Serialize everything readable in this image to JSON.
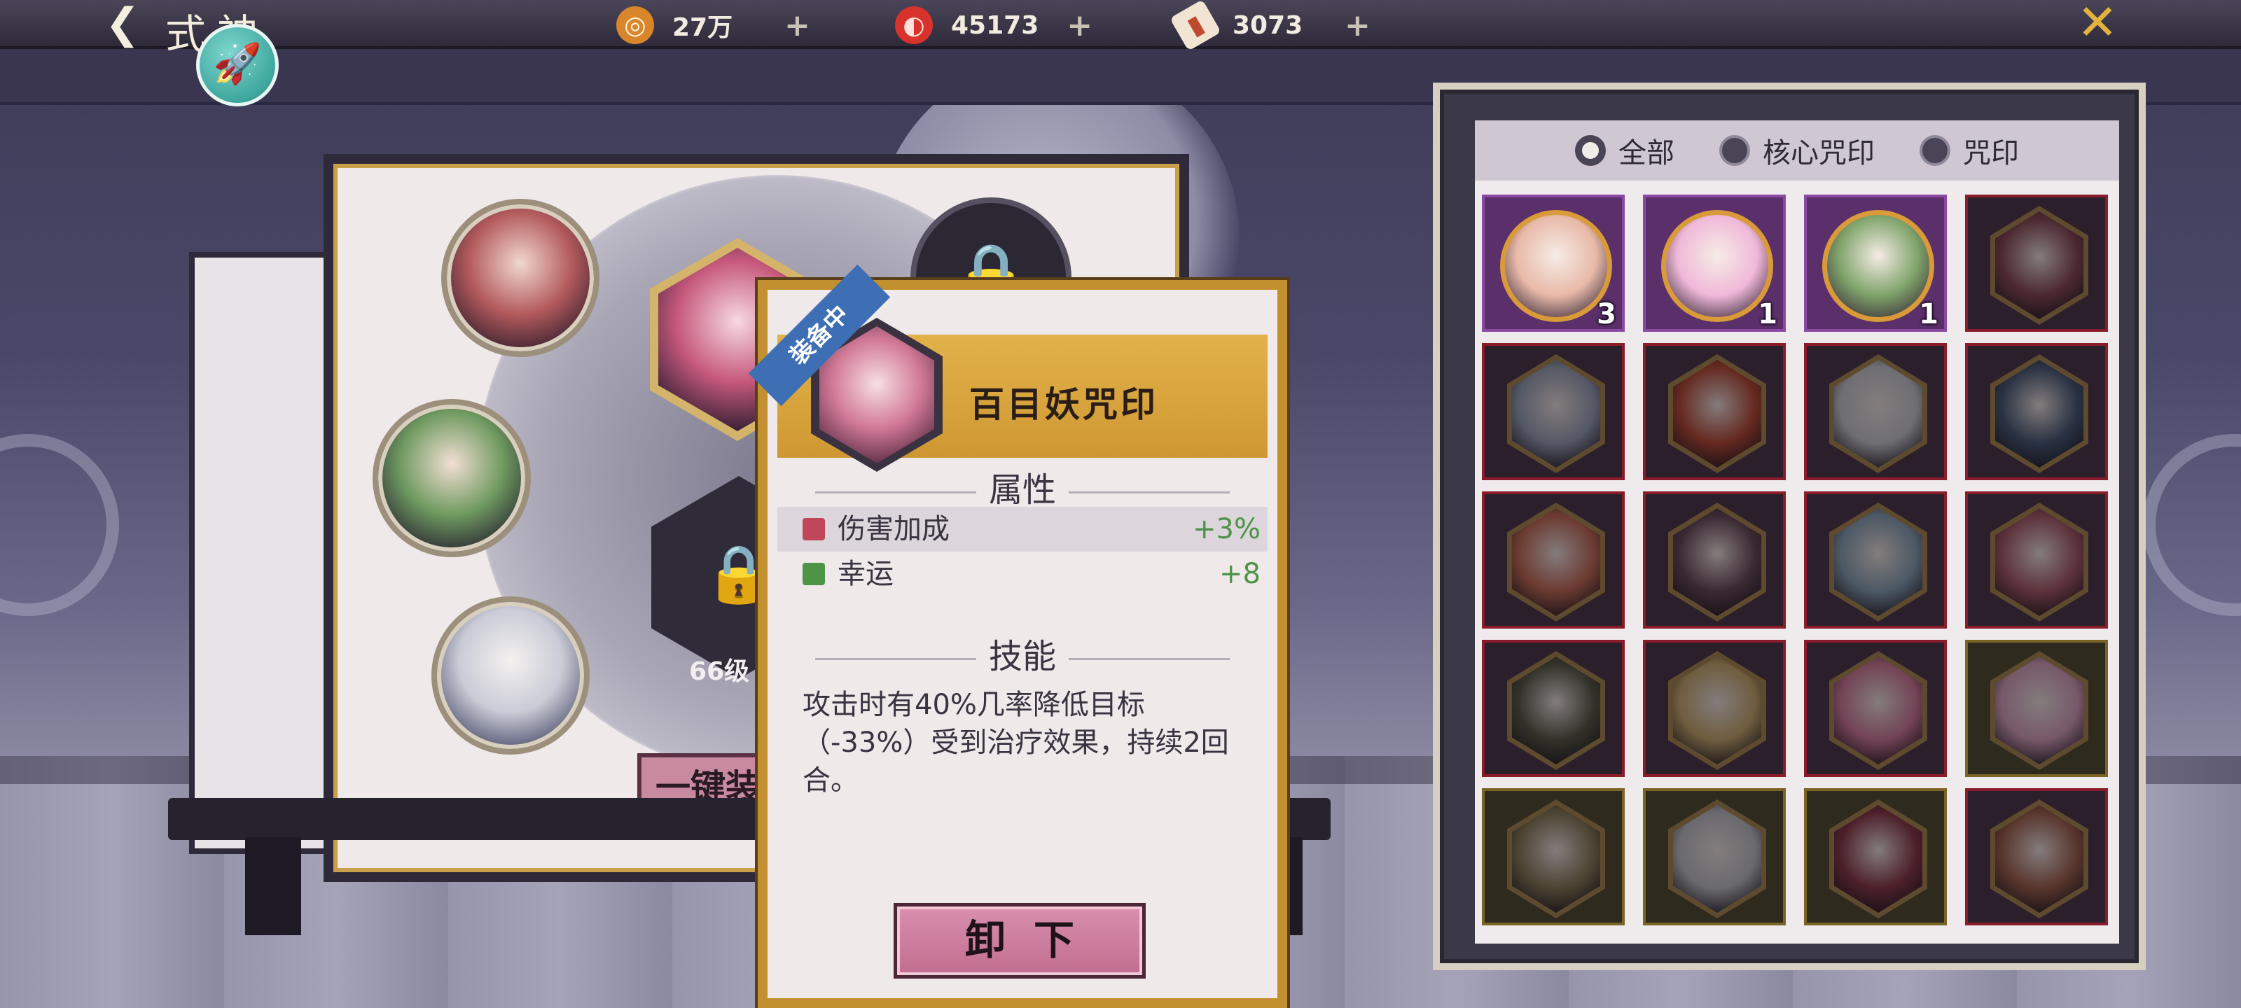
{
  "topbar": {
    "title": "式神",
    "resources": [
      {
        "name": "gold",
        "value": "27万",
        "icon": "coin-icon",
        "color": "#d9852c"
      },
      {
        "name": "jade",
        "value": "45173",
        "icon": "magatama-icon",
        "color": "#d8322c"
      },
      {
        "name": "ticket",
        "value": "3073",
        "icon": "talisman-icon",
        "color": "#e07c5a"
      }
    ],
    "plus": "+"
  },
  "equip_panel": {
    "locked_level_label": "66级",
    "equip_all_button": "一键装"
  },
  "tooltip": {
    "equipped_badge": "装备中",
    "name": "百目妖咒印",
    "attributes_title": "属性",
    "attributes": [
      {
        "label": "伤害加成",
        "value": "+3%",
        "icon_color": "#c0475a"
      },
      {
        "label": "幸运",
        "value": "+8",
        "icon_color": "#4e9446"
      }
    ],
    "skill_title": "技能",
    "skill_text": "攻击时有40%几率降低目标（-33%）受到治疗效果，持续2回合。",
    "unequip_button": "卸下"
  },
  "inventory": {
    "filters": [
      {
        "label": "全部",
        "selected": true
      },
      {
        "label": "核心咒印",
        "selected": false
      },
      {
        "label": "咒印",
        "selected": false
      }
    ],
    "items": [
      {
        "type": "core",
        "count": "3",
        "palette": "#e8b9a8"
      },
      {
        "type": "core",
        "count": "1",
        "palette": "#f0b8d8"
      },
      {
        "type": "core",
        "count": "1",
        "palette": "#7fa36a"
      },
      {
        "type": "seal",
        "count": "",
        "palette": "#8a4a5a"
      },
      {
        "type": "seal",
        "count": "",
        "palette": "#9aa0b8"
      },
      {
        "type": "seal",
        "count": "",
        "palette": "#b84a3a"
      },
      {
        "type": "seal",
        "count": "",
        "palette": "#c8c8d2"
      },
      {
        "type": "seal",
        "count": "",
        "palette": "#4a5a7a"
      },
      {
        "type": "seal",
        "count": "",
        "palette": "#c46a5a"
      },
      {
        "type": "seal",
        "count": "",
        "palette": "#6a4a5a"
      },
      {
        "type": "seal",
        "count": "",
        "palette": "#8aa0b8"
      },
      {
        "type": "seal",
        "count": "",
        "palette": "#a85a6a"
      },
      {
        "type": "seal",
        "count": "",
        "palette": "#5a5a4a"
      },
      {
        "type": "seal",
        "count": "",
        "palette": "#c8a870"
      },
      {
        "type": "seal",
        "count": "",
        "palette": "#d07a9a"
      },
      {
        "type": "seal-gold",
        "count": "",
        "palette": "#d8a0c0"
      },
      {
        "type": "seal-gold",
        "count": "",
        "palette": "#8a7a5a"
      },
      {
        "type": "seal-gold",
        "count": "",
        "palette": "#c0c0c8"
      },
      {
        "type": "seal-gold",
        "count": "",
        "palette": "#8a3a4a"
      },
      {
        "type": "seal",
        "count": "",
        "palette": "#a06050"
      }
    ]
  }
}
